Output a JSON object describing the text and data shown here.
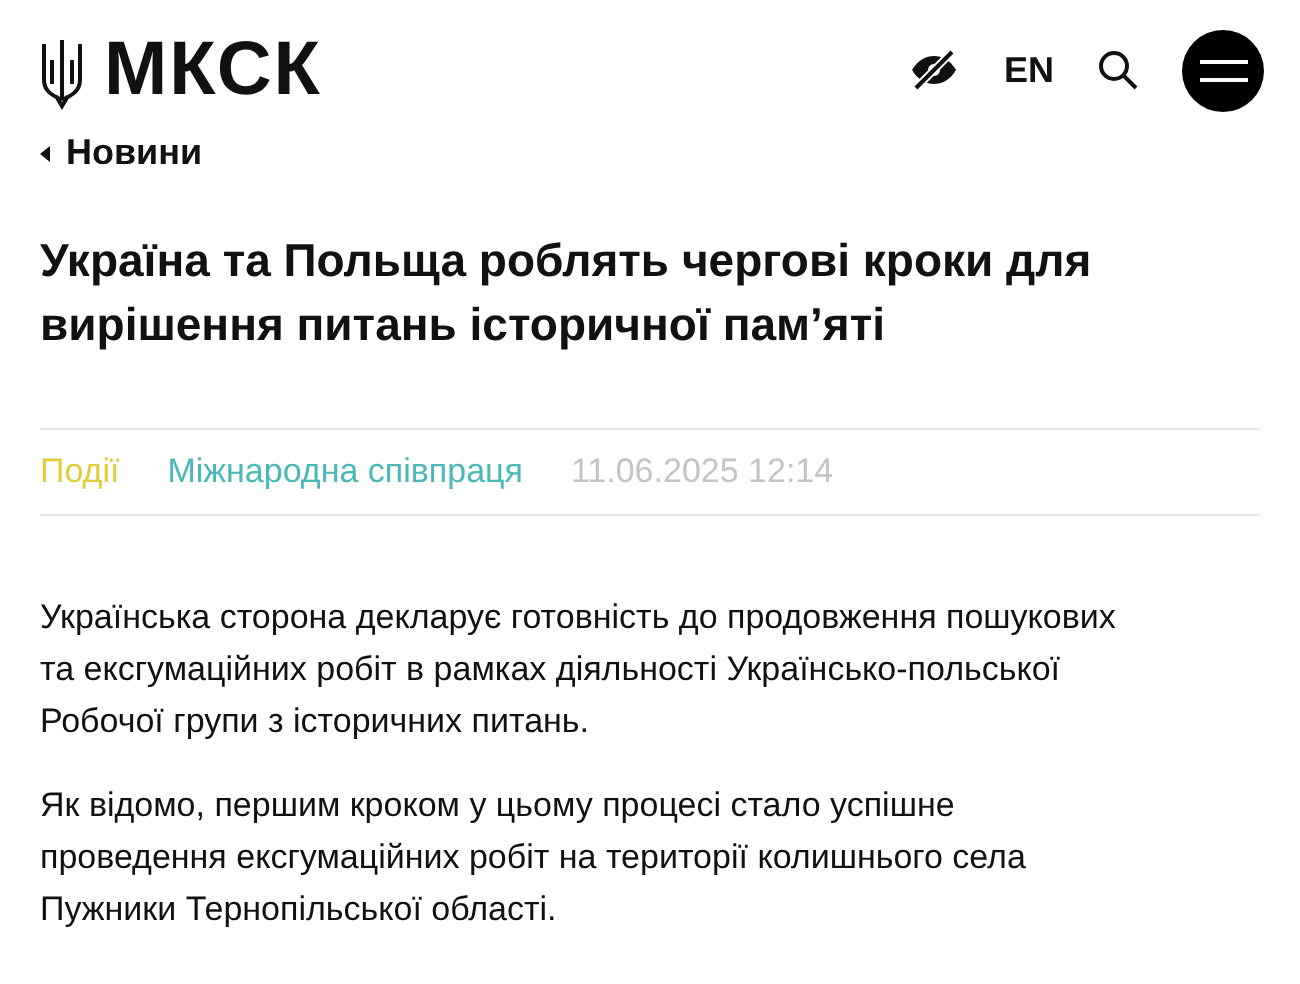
{
  "header": {
    "logo": "МКСК",
    "language": "EN"
  },
  "back_link": "Новини",
  "title": "Україна та Польща роблять чергові кроки для вирішення питань історичної пам’яті",
  "tags": [
    {
      "label": "Події",
      "color": "#e0cd3c"
    },
    {
      "label": "Міжнародна співпраця",
      "color": "#4bb8b8"
    }
  ],
  "date": "11.06.2025 12:14",
  "paragraphs": [
    "Українська сторона декларує готовність до продовження пошукових та ексгумаційних робіт в рамках діяльності Українсько-польської Робочої групи з історичних питань.",
    "Як відомо, першим кроком у цьому процесі стало успішне проведення ексгумаційних робіт на території колишнього села Пужники Тернопільської області."
  ]
}
